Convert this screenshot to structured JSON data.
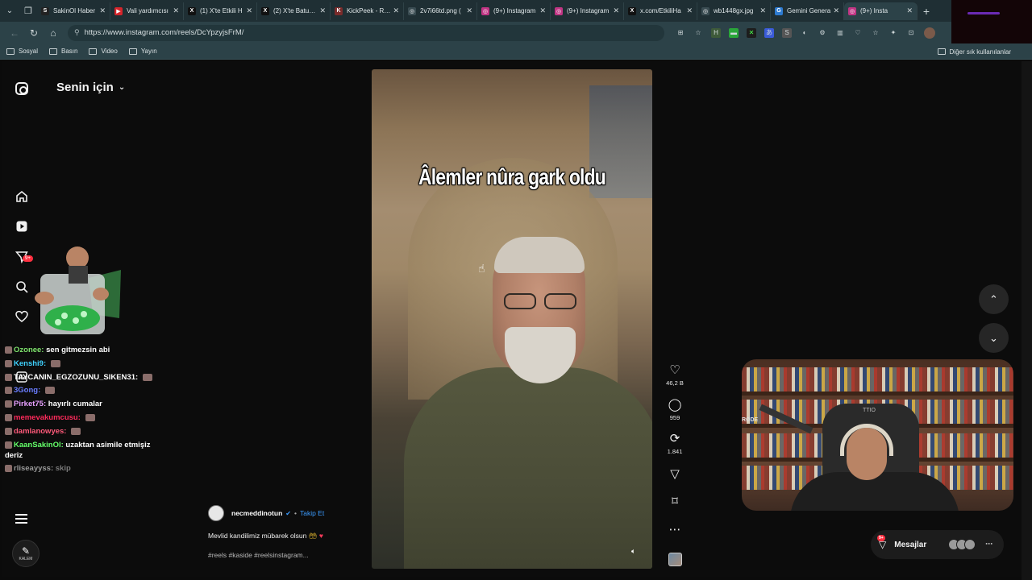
{
  "browser": {
    "tabs": [
      {
        "label": "SakinOl Haber",
        "color": "#222222",
        "glyph": "S"
      },
      {
        "label": "Vali yardımcısı",
        "color": "#d5252b",
        "glyph": "▶"
      },
      {
        "label": "(1) X'te Etkili H",
        "color": "#111111",
        "glyph": "X"
      },
      {
        "label": "(2) X'te Batuhan",
        "color": "#111111",
        "glyph": "X"
      },
      {
        "label": "KickPeek - Rea",
        "color": "#7a2b2b",
        "glyph": "K"
      },
      {
        "label": "2v7i66td.png (",
        "color": "#3a4c52",
        "glyph": "◎"
      },
      {
        "label": "(9+) Instagram",
        "color": "#c13584",
        "glyph": "◎"
      },
      {
        "label": "(9+) Instagram",
        "color": "#c13584",
        "glyph": "◎"
      },
      {
        "label": "x.com/EtkiliHa",
        "color": "#111111",
        "glyph": "X"
      },
      {
        "label": "wb1448gx.jpg",
        "color": "#3a4c52",
        "glyph": "◎"
      },
      {
        "label": "Gemini Genera",
        "color": "#2d7bd1",
        "glyph": "G"
      },
      {
        "label": "(9+) Insta",
        "color": "#c13584",
        "glyph": "◎"
      }
    ],
    "url": "https://www.instagram.com/reels/DcYpzyjsFrM/",
    "bookmarks": [
      "Sosyal",
      "Basın",
      "Video",
      "Yayın"
    ],
    "other_bookmarks": "Diğer sık kullanılanlar"
  },
  "feed": {
    "title": "Senin için",
    "notif_badge": "9+"
  },
  "chat": [
    {
      "user": "Ozonee:",
      "text": "sen gitmezsin abi",
      "cls": "u1"
    },
    {
      "user": "Kenshi9:",
      "text": "",
      "cls": "u2"
    },
    {
      "user": "TAYCANIN_EGZOZUNU_SIKEN31:",
      "text": "",
      "cls": "u3"
    },
    {
      "user": "3Gong:",
      "text": "",
      "cls": "u4"
    },
    {
      "user": "Pirket75:",
      "text": "hayırlı cumalar",
      "cls": "u5"
    },
    {
      "user": "memevakumcusu:",
      "text": "",
      "cls": "u6"
    },
    {
      "user": "damlanowyes:",
      "text": "",
      "cls": "u7"
    },
    {
      "user": "KaanSakinOl:",
      "text": "uzaktan asimile etmişiz deriz",
      "cls": "u8"
    },
    {
      "user": "rliseayyss:",
      "text": "skip",
      "cls": "u9"
    }
  ],
  "kalem_label": "KALEM",
  "video": {
    "caption": "Âlemler nûra gark oldu",
    "likes": "46,2 B",
    "comments": "959",
    "reposts": "1.841"
  },
  "author": {
    "name": "necmeddinotun",
    "follow": "Takip Et",
    "description": "Mevlid kandilimiz mübarek olsun",
    "tags": "#reels #kaside #reelsinstagram..."
  },
  "webcam": {
    "mic_label": "RØDE",
    "chair_label": "TTIO"
  },
  "messages": {
    "label": "Mesajlar",
    "badge": "9+"
  }
}
